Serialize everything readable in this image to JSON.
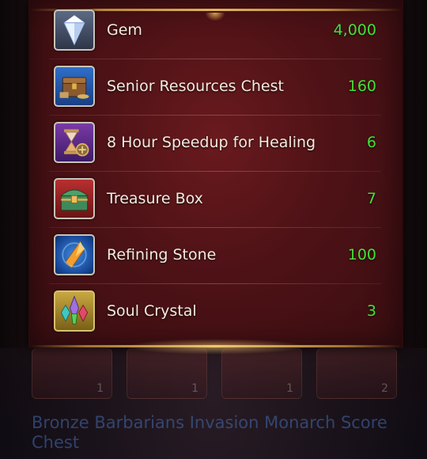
{
  "rewards": [
    {
      "name": "Gem",
      "quantity": "4,000",
      "icon": "gem-icon"
    },
    {
      "name": "Senior Resources Chest",
      "quantity": "160",
      "icon": "resources-chest-icon"
    },
    {
      "name": "8 Hour Speedup for Healing",
      "quantity": "6",
      "icon": "healing-speedup-icon"
    },
    {
      "name": "Treasure Box",
      "quantity": "7",
      "icon": "treasure-box-icon"
    },
    {
      "name": "Refining Stone",
      "quantity": "100",
      "icon": "refining-stone-icon"
    },
    {
      "name": "Soul Crystal",
      "quantity": "3",
      "icon": "soul-crystal-icon"
    }
  ],
  "background": {
    "slots": [
      "1",
      "1",
      "1",
      "2"
    ],
    "title": "Bronze Barbarians Invasion Monarch Score Chest"
  },
  "colors": {
    "panel": "#4e1216",
    "quantity": "#44e03a",
    "item_text": "#f2ebe0",
    "gold_trim": "#e0b45a"
  }
}
